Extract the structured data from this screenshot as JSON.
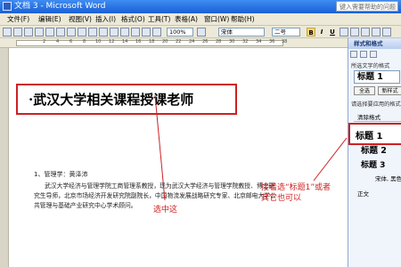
{
  "window": {
    "title": "文档 3 - Microsoft Word",
    "help_placeholder": "键入需要帮助的问题"
  },
  "menu": [
    "文件(F)",
    "编辑(E)",
    "视图(V)",
    "插入(I)",
    "格式(O)",
    "工具(T)",
    "表格(A)",
    "窗口(W)",
    "帮助(H)"
  ],
  "toolbar": {
    "zoom": "100%",
    "font": "宋体",
    "size": "二号",
    "bold": "B",
    "italic": "I",
    "underline": "U"
  },
  "ruler": {
    "numbers": [
      "2",
      "4",
      "6",
      "8",
      "10",
      "12",
      "14",
      "16",
      "18",
      "20",
      "22",
      "24",
      "26",
      "28",
      "30",
      "32",
      "34",
      "36",
      "38"
    ]
  },
  "document": {
    "heading": "·武汉大学相关课程授课老师",
    "author_line": "1、管理学：",
    "author_name": "黄泽沛",
    "body": [
      "武汉大学经济与管理学院工商管理系教授，现为武汉大学经济与管理学院教授、博士研",
      "究生导师，北京市场经济开发研究院副院长，中国物流发展战略研究专家、北京邮电大学公",
      "共管理与基础产业研究中心学术顾问。"
    ]
  },
  "annotations": {
    "select_this": "选中这",
    "then_select_1": "接着选“标题1”或者",
    "then_select_2": "其它也可以",
    "color": "#cc2222"
  },
  "styles_pane": {
    "header": "样式和格式",
    "section_selected": "所选文字的格式",
    "current_style": "标题 1",
    "btn_select_all": "全选",
    "btn_new": "新样式",
    "section_apply": "请选择要应用的格式",
    "clear_format": "清除格式",
    "styles": [
      "标题 1",
      "标题 2",
      "标题 3",
      "宋体, 黑色",
      "正文"
    ]
  }
}
